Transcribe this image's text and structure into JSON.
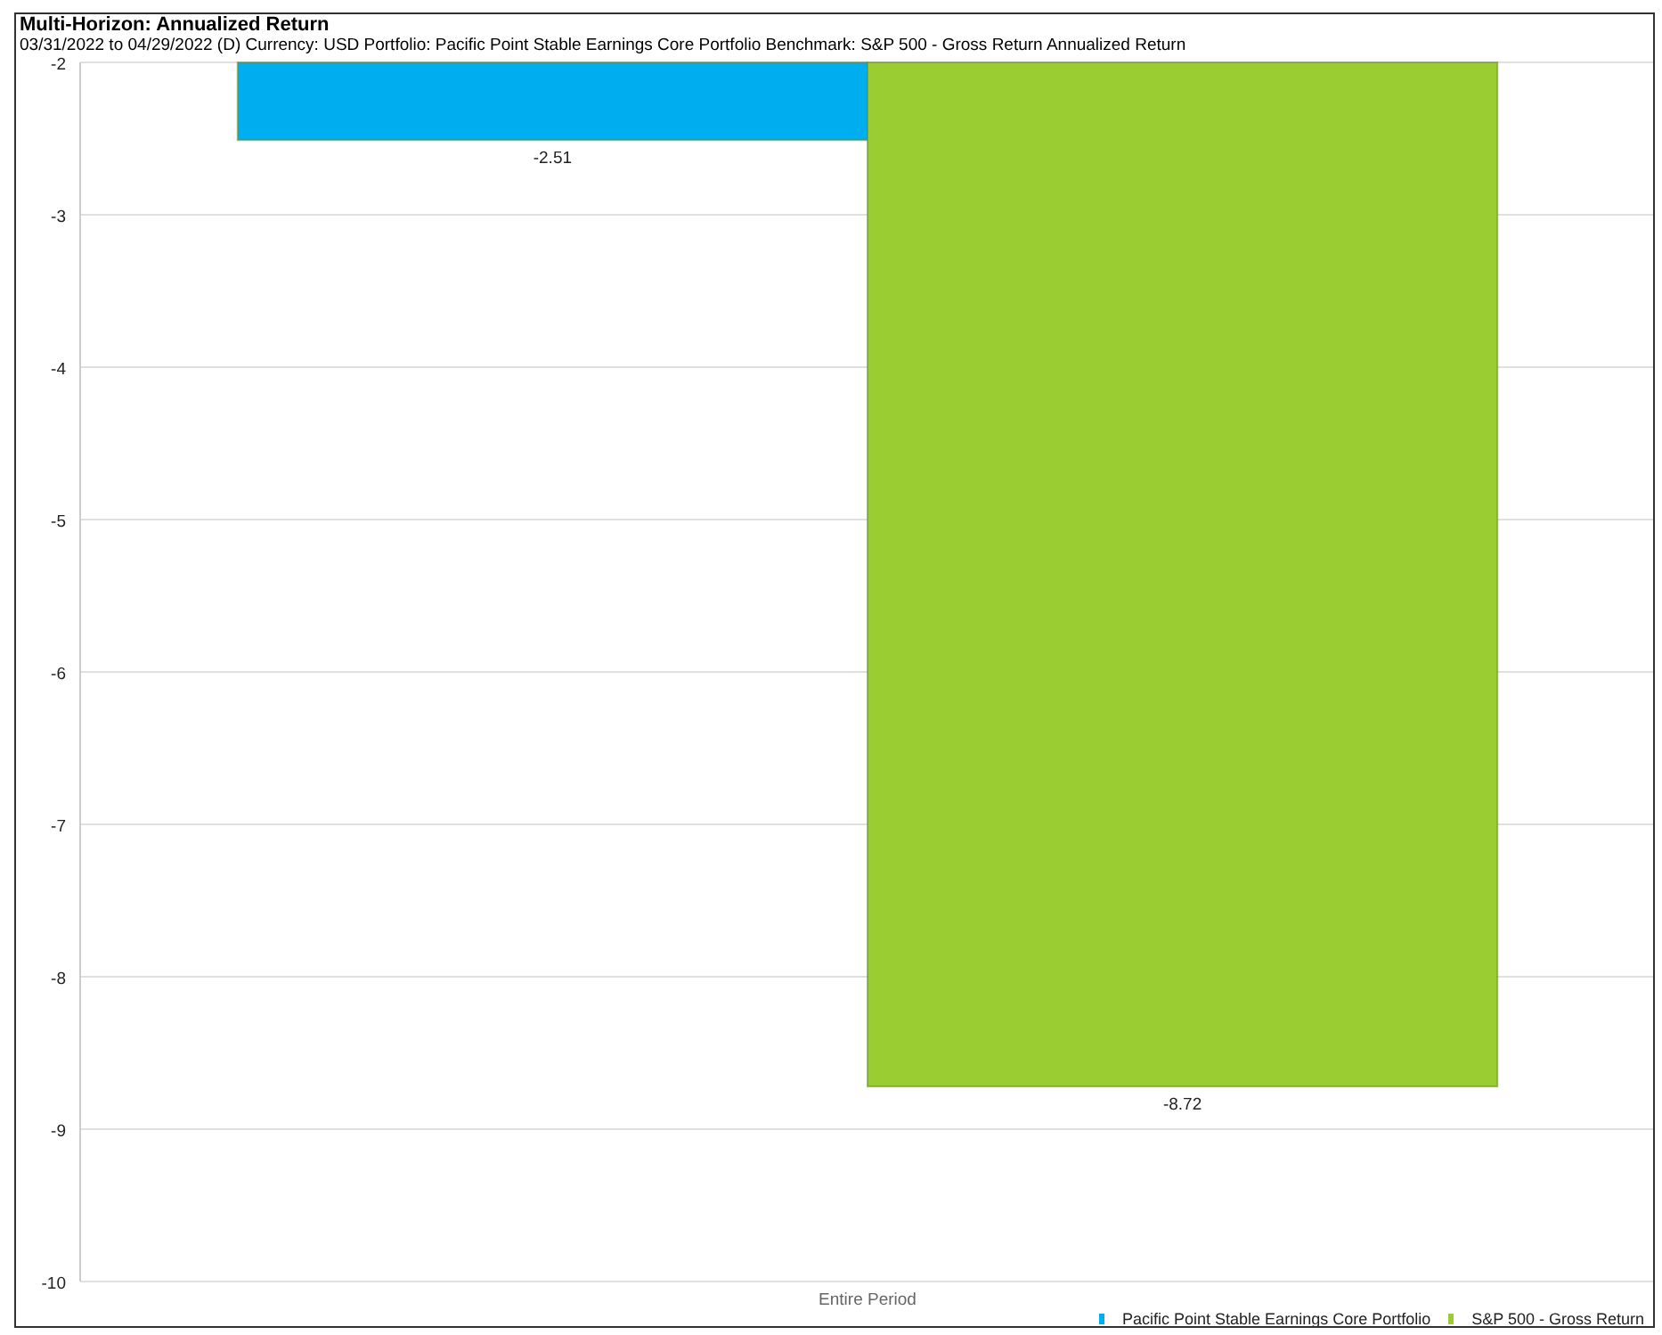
{
  "title": "Multi-Horizon: Annualized Return",
  "subtitle": "03/31/2022 to 04/29/2022 (D) Currency: USD Portfolio: Pacific Point Stable Earnings Core Portfolio Benchmark: S&P 500 - Gross Return Annualized Return",
  "chart_data": {
    "type": "bar",
    "categories": [
      "Entire Period"
    ],
    "series": [
      {
        "name": "Pacific Point Stable Earnings Core Portfolio",
        "color": "#00adef",
        "values": [
          -2.51
        ]
      },
      {
        "name": "S&P 500 - Gross Return",
        "color": "#9acd32",
        "values": [
          -8.72
        ]
      }
    ],
    "ylim": [
      -10,
      -2
    ],
    "grid": true,
    "legend": true,
    "yticks": [
      -2,
      -3,
      -4,
      -5,
      -6,
      -7,
      -8,
      -9,
      -10
    ],
    "data_labels": true
  }
}
